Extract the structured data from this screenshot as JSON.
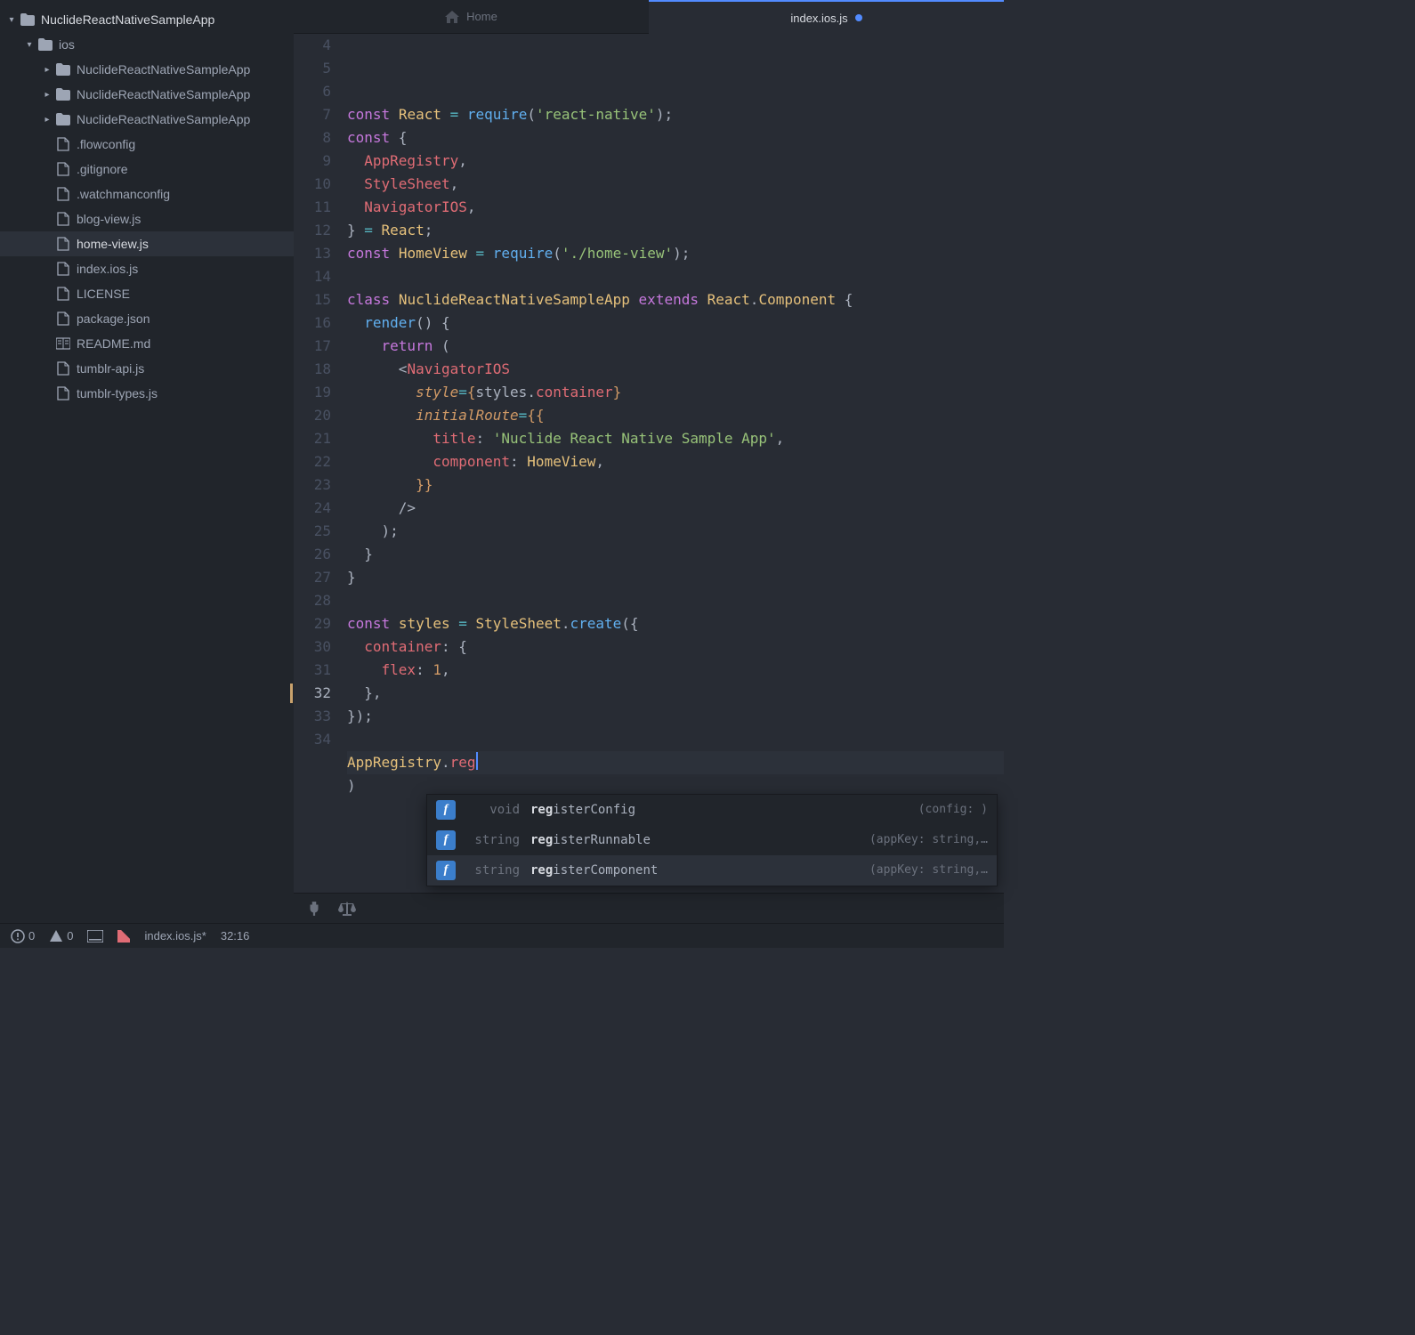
{
  "tree": {
    "root": "NuclideReactNativeSampleApp",
    "folder_ios": "ios",
    "subdirs": [
      "NuclideReactNativeSampleApp",
      "NuclideReactNativeSampleApp",
      "NuclideReactNativeSampleApp"
    ],
    "files": [
      ".flowconfig",
      ".gitignore",
      ".watchmanconfig",
      "blog-view.js",
      "home-view.js",
      "index.ios.js",
      "LICENSE",
      "package.json",
      "README.md",
      "tumblr-api.js",
      "tumblr-types.js"
    ],
    "selected": "home-view.js"
  },
  "tabs": {
    "home": "Home",
    "file": "index.ios.js",
    "modified": true
  },
  "editor": {
    "first_line_number": 4,
    "highlight_line_number": 32,
    "lines": [
      [
        [
          "c-kw",
          "const"
        ],
        [
          "c-pn",
          " "
        ],
        [
          "c-var",
          "React"
        ],
        [
          "c-pn",
          " "
        ],
        [
          "c-op",
          "="
        ],
        [
          "c-pn",
          " "
        ],
        [
          "c-call",
          "require"
        ],
        [
          "c-pn",
          "("
        ],
        [
          "c-str",
          "'react-native'"
        ],
        [
          "c-pn",
          ");"
        ]
      ],
      [
        [
          "c-kw",
          "const"
        ],
        [
          "c-pn",
          " {"
        ]
      ],
      [
        [
          "c-pn",
          "  "
        ],
        [
          "c-fn",
          "AppRegistry"
        ],
        [
          "c-pn",
          ","
        ]
      ],
      [
        [
          "c-pn",
          "  "
        ],
        [
          "c-fn",
          "StyleSheet"
        ],
        [
          "c-pn",
          ","
        ]
      ],
      [
        [
          "c-pn",
          "  "
        ],
        [
          "c-fn",
          "NavigatorIOS"
        ],
        [
          "c-pn",
          ","
        ]
      ],
      [
        [
          "c-pn",
          "} "
        ],
        [
          "c-op",
          "="
        ],
        [
          "c-pn",
          " "
        ],
        [
          "c-var",
          "React"
        ],
        [
          "c-pn",
          ";"
        ]
      ],
      [
        [
          "c-kw",
          "const"
        ],
        [
          "c-pn",
          " "
        ],
        [
          "c-var",
          "HomeView"
        ],
        [
          "c-pn",
          " "
        ],
        [
          "c-op",
          "="
        ],
        [
          "c-pn",
          " "
        ],
        [
          "c-call",
          "require"
        ],
        [
          "c-pn",
          "("
        ],
        [
          "c-str",
          "'./home-view'"
        ],
        [
          "c-pn",
          ");"
        ]
      ],
      [],
      [
        [
          "c-kw",
          "class"
        ],
        [
          "c-pn",
          " "
        ],
        [
          "c-var",
          "NuclideReactNativeSampleApp"
        ],
        [
          "c-pn",
          " "
        ],
        [
          "c-kw",
          "extends"
        ],
        [
          "c-pn",
          " "
        ],
        [
          "c-var",
          "React"
        ],
        [
          "c-pn",
          "."
        ],
        [
          "c-var",
          "Component"
        ],
        [
          "c-pn",
          " {"
        ]
      ],
      [
        [
          "c-pn",
          "  "
        ],
        [
          "c-call",
          "render"
        ],
        [
          "c-pn",
          "() {"
        ]
      ],
      [
        [
          "c-pn",
          "    "
        ],
        [
          "c-kw",
          "return"
        ],
        [
          "c-pn",
          " ("
        ]
      ],
      [
        [
          "c-pn",
          "      <"
        ],
        [
          "c-jsx",
          "NavigatorIOS"
        ]
      ],
      [
        [
          "c-pn",
          "        "
        ],
        [
          "c-attr",
          "style"
        ],
        [
          "c-op",
          "="
        ],
        [
          "c-br",
          "{"
        ],
        [
          "c-pn",
          "styles"
        ],
        [
          "c-pn",
          "."
        ],
        [
          "c-fn",
          "container"
        ],
        [
          "c-br",
          "}"
        ]
      ],
      [
        [
          "c-pn",
          "        "
        ],
        [
          "c-attr",
          "initialRoute"
        ],
        [
          "c-op",
          "="
        ],
        [
          "c-br",
          "{{"
        ]
      ],
      [
        [
          "c-pn",
          "          "
        ],
        [
          "c-fn",
          "title"
        ],
        [
          "c-pn",
          ": "
        ],
        [
          "c-str",
          "'Nuclide React Native Sample App'"
        ],
        [
          "c-pn",
          ","
        ]
      ],
      [
        [
          "c-pn",
          "          "
        ],
        [
          "c-fn",
          "component"
        ],
        [
          "c-pn",
          ": "
        ],
        [
          "c-var",
          "HomeView"
        ],
        [
          "c-pn",
          ","
        ]
      ],
      [
        [
          "c-pn",
          "        "
        ],
        [
          "c-br",
          "}}"
        ]
      ],
      [
        [
          "c-pn",
          "      />"
        ]
      ],
      [
        [
          "c-pn",
          "    );"
        ]
      ],
      [
        [
          "c-pn",
          "  }"
        ]
      ],
      [
        [
          "c-pn",
          "}"
        ]
      ],
      [],
      [
        [
          "c-kw",
          "const"
        ],
        [
          "c-pn",
          " "
        ],
        [
          "c-var",
          "styles"
        ],
        [
          "c-pn",
          " "
        ],
        [
          "c-op",
          "="
        ],
        [
          "c-pn",
          " "
        ],
        [
          "c-var",
          "StyleSheet"
        ],
        [
          "c-pn",
          "."
        ],
        [
          "c-call",
          "create"
        ],
        [
          "c-pn",
          "({"
        ]
      ],
      [
        [
          "c-pn",
          "  "
        ],
        [
          "c-fn",
          "container"
        ],
        [
          "c-pn",
          ": {"
        ]
      ],
      [
        [
          "c-pn",
          "    "
        ],
        [
          "c-fn",
          "flex"
        ],
        [
          "c-pn",
          ": "
        ],
        [
          "c-num",
          "1"
        ],
        [
          "c-pn",
          ","
        ]
      ],
      [
        [
          "c-pn",
          "  },"
        ]
      ],
      [
        [
          "c-pn",
          "});"
        ]
      ],
      [],
      [
        [
          "c-var",
          "AppRegistry"
        ],
        [
          "c-pn",
          "."
        ],
        [
          "c-fn",
          "reg"
        ],
        [
          "cursor",
          ""
        ]
      ],
      [
        [
          "c-pn",
          ")"
        ]
      ],
      []
    ]
  },
  "autocomplete": {
    "kind_label": "f",
    "items": [
      {
        "ret": "void",
        "match": "reg",
        "rest": "isterConfig",
        "sig": "(config: )"
      },
      {
        "ret": "string",
        "match": "reg",
        "rest": "isterRunnable",
        "sig": "(appKey: string,…"
      },
      {
        "ret": "string",
        "match": "reg",
        "rest": "isterComponent",
        "sig": "(appKey: string,…"
      }
    ],
    "selected_index": 2
  },
  "status": {
    "errors": "0",
    "warnings": "0",
    "filename": "index.ios.js*",
    "cursor": "32:16"
  }
}
